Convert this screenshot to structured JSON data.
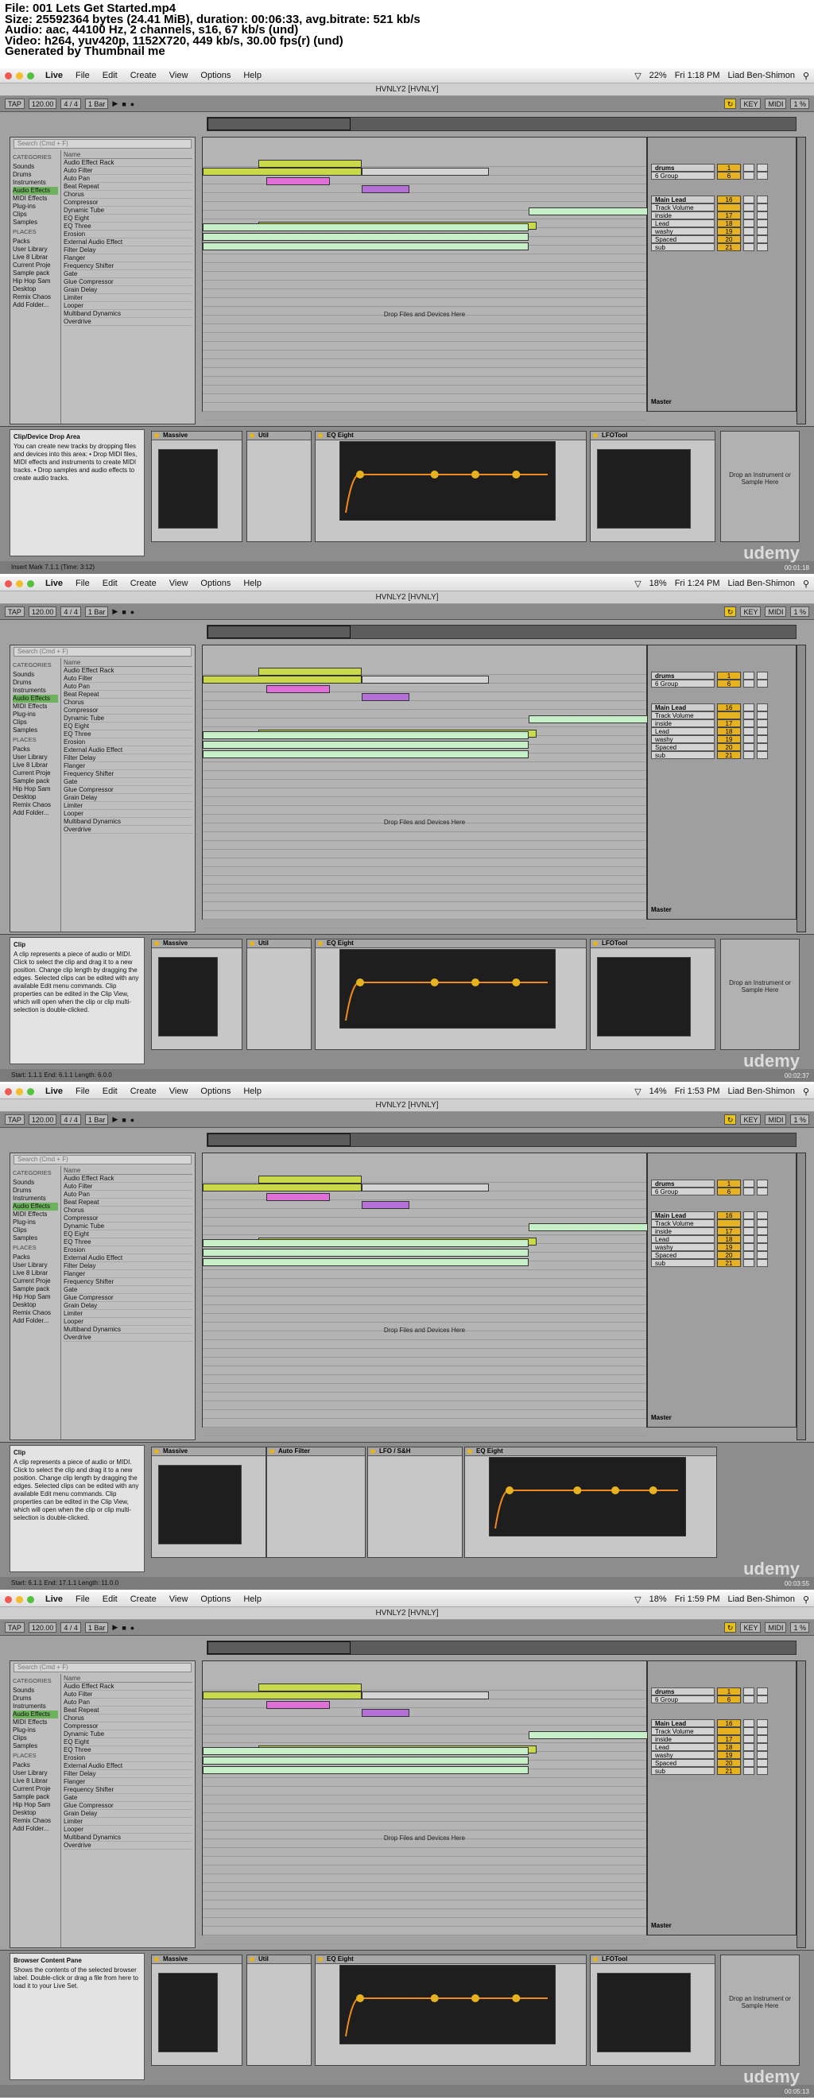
{
  "header": {
    "lines": [
      "File: 001 Lets Get Started.mp4",
      "Size: 25592364 bytes (24.41 MiB), duration: 00:06:33, avg.bitrate: 521 kb/s",
      "Audio: aac, 44100 Hz, 2 channels, s16, 67 kb/s (und)",
      "Video: h264, yuv420p, 1152X720, 449 kb/s, 30.00 fps(r) (und)",
      "Generated by Thumbnail me"
    ]
  },
  "frames": [
    {
      "time": "Fri 1:18 PM",
      "battery": "22%",
      "window_title": "HVNLY2 [HVNLY]",
      "tempo": "120.00",
      "sig": "4 / 4",
      "info_title": "Clip/Device Drop Area",
      "info_text": "You can create new tracks by dropping files and devices into this area: • Drop MIDI files, MIDI effects and instruments to create MIDI tracks. • Drop samples and audio effects to create audio tracks.",
      "status": "Insert Mark 7.1.1 (Time: 3:12)",
      "timestamp": "00:01:18",
      "devices": [
        "Massive",
        "Util",
        "EQ Eight",
        "LFOTool"
      ]
    },
    {
      "time": "Fri 1:24 PM",
      "battery": "18%",
      "window_title": "HVNLY2 [HVNLY]",
      "tempo": "120.00",
      "sig": "4 / 4",
      "info_title": "Clip",
      "info_text": "A clip represents a piece of audio or MIDI. Click to select the clip and drag it to a new position. Change clip length by dragging the edges. Selected clips can be edited with any available Edit menu commands. Clip properties can be edited in the Clip View, which will open when the clip or clip multi-selection is double-clicked.",
      "status": "Start: 1.1.1  End: 6.1.1  Length: 6.0.0",
      "timestamp": "00:02:37",
      "devices": [
        "Massive",
        "Util",
        "EQ Eight",
        "LFOTool"
      ]
    },
    {
      "time": "Fri 1:53 PM",
      "battery": "14%",
      "window_title": "HVNLY2 [HVNLY]",
      "tempo": "120.00",
      "sig": "4 / 4",
      "info_title": "Clip",
      "info_text": "A clip represents a piece of audio or MIDI. Click to select the clip and drag it to a new position. Change clip length by dragging the edges. Selected clips can be edited with any available Edit menu commands. Clip properties can be edited in the Clip View, which will open when the clip or clip multi-selection is double-clicked.",
      "status": "Start: 6.1.1  End: 17.1.1  Length: 11.0.0",
      "timestamp": "00:03:55",
      "devices": [
        "Massive",
        "Auto Filter",
        "LFO / S&H",
        "EQ Eight"
      ]
    },
    {
      "time": "Fri 1:59 PM",
      "battery": "18%",
      "window_title": "HVNLY2 [HVNLY]",
      "tempo": "120.00",
      "sig": "4 / 4",
      "info_title": "Browser Content Pane",
      "info_text": "Shows the contents of the selected browser label. Double-click or drag a file from here to load it to your Live Set.",
      "status": "",
      "timestamp": "00:05:13",
      "devices": [
        "Massive",
        "Util",
        "EQ Eight",
        "LFOTool"
      ]
    }
  ],
  "menu": {
    "app": "Live",
    "items": [
      "File",
      "Edit",
      "Create",
      "View",
      "Options",
      "Help"
    ],
    "user": "Liad Ben-Shimon"
  },
  "transport": {
    "tap": "TAP",
    "quant": "1 Bar",
    "key": "KEY",
    "midi": "MIDI",
    "cpu": "1 %"
  },
  "browser": {
    "search": "Search (Cmd + F)",
    "categories_label": "CATEGORIES",
    "categories": [
      "Sounds",
      "Drums",
      "Instruments",
      "Audio Effects",
      "MIDI Effects",
      "Plug-ins",
      "Clips",
      "Samples"
    ],
    "places_label": "PLACES",
    "places": [
      "Packs",
      "User Library",
      "Live 8 Librar",
      "Current Proje",
      "Sample pack",
      "Hip Hop Sam",
      "Desktop",
      "Remix Chaos",
      "Add Folder..."
    ],
    "name_label": "Name",
    "items": [
      "Audio Effect Rack",
      "Auto Filter",
      "Auto Pan",
      "Beat Repeat",
      "Chorus",
      "Compressor",
      "Dynamic Tube",
      "EQ Eight",
      "EQ Three",
      "Erosion",
      "External Audio Effect",
      "Filter Delay",
      "Flanger",
      "Frequency Shifter",
      "Gate",
      "Glue Compressor",
      "Grain Delay",
      "Limiter",
      "Looper",
      "Multiband Dynamics",
      "Overdrive"
    ]
  },
  "arrangement": {
    "drop_text": "Drop Files and Devices Here",
    "master": "Master"
  },
  "track_list": [
    {
      "name": "drums",
      "num": "1"
    },
    {
      "name": "6 Group",
      "num": "6"
    },
    {
      "name": "Main Lead",
      "num": "16"
    },
    {
      "name": "Track Volume",
      "num": ""
    },
    {
      "name": "inside",
      "num": "17"
    },
    {
      "name": "Lead",
      "num": "18"
    },
    {
      "name": "washy",
      "num": "19"
    },
    {
      "name": "Spaced",
      "num": "20"
    },
    {
      "name": "sub",
      "num": "21"
    }
  ],
  "right_drop": "Drop an Instrument or Sample Here",
  "brand": "udemy",
  "colors": {
    "accent_green": "#6db25c",
    "clip_green": "#c7f0c9",
    "lime": "#c9d94a",
    "pink": "#e070d8",
    "yellow": "#e6b220"
  }
}
